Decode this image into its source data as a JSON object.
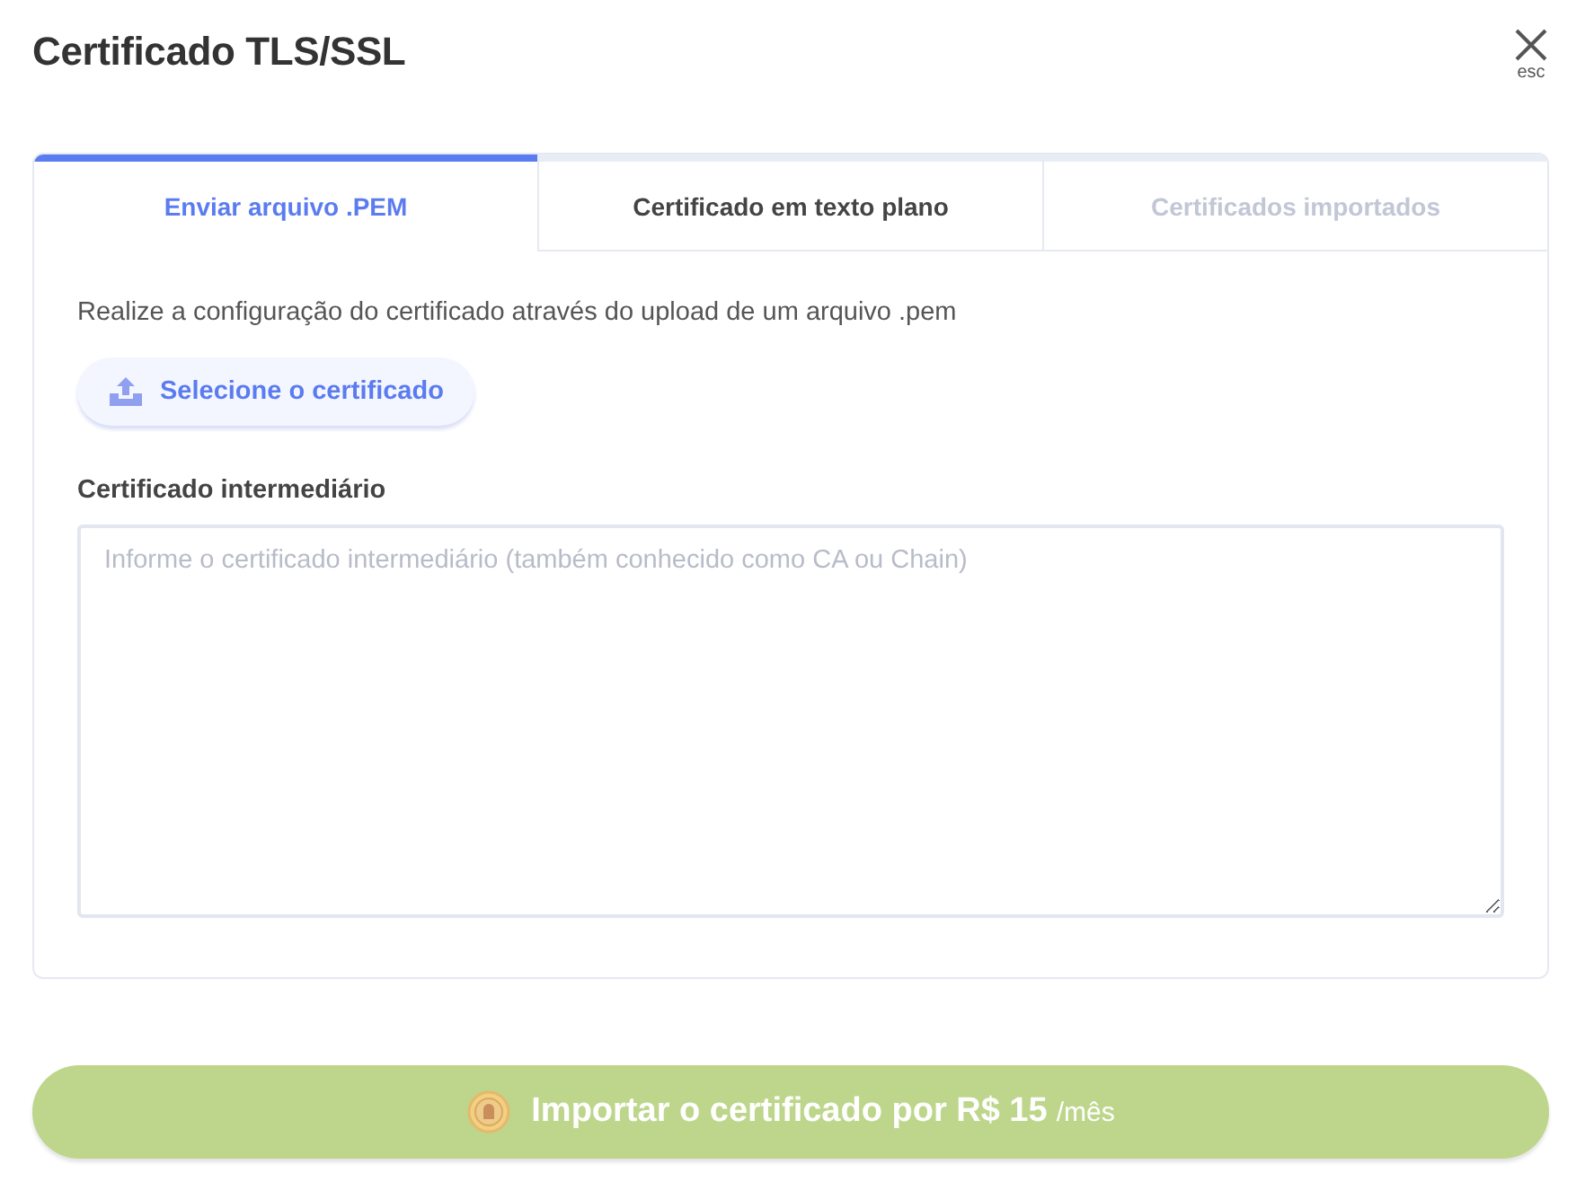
{
  "dialog": {
    "title": "Certificado TLS/SSL",
    "close_hint": "esc"
  },
  "tabs": [
    {
      "label": "Enviar arquivo .PEM",
      "selected": true,
      "disabled": false
    },
    {
      "label": "Certificado em texto plano",
      "selected": false,
      "disabled": false
    },
    {
      "label": "Certificados importados",
      "selected": false,
      "disabled": true
    }
  ],
  "description": "Realize a configuração do certificado através do upload de um arquivo .pem",
  "upload_button": "Selecione o certificado",
  "intermediate": {
    "label": "Certificado intermediário",
    "placeholder": "Informe o certificado intermediário (também conhecido como CA ou Chain)"
  },
  "submit": {
    "label": "Importar o certificado por R$ 15",
    "period": "/mês"
  }
}
